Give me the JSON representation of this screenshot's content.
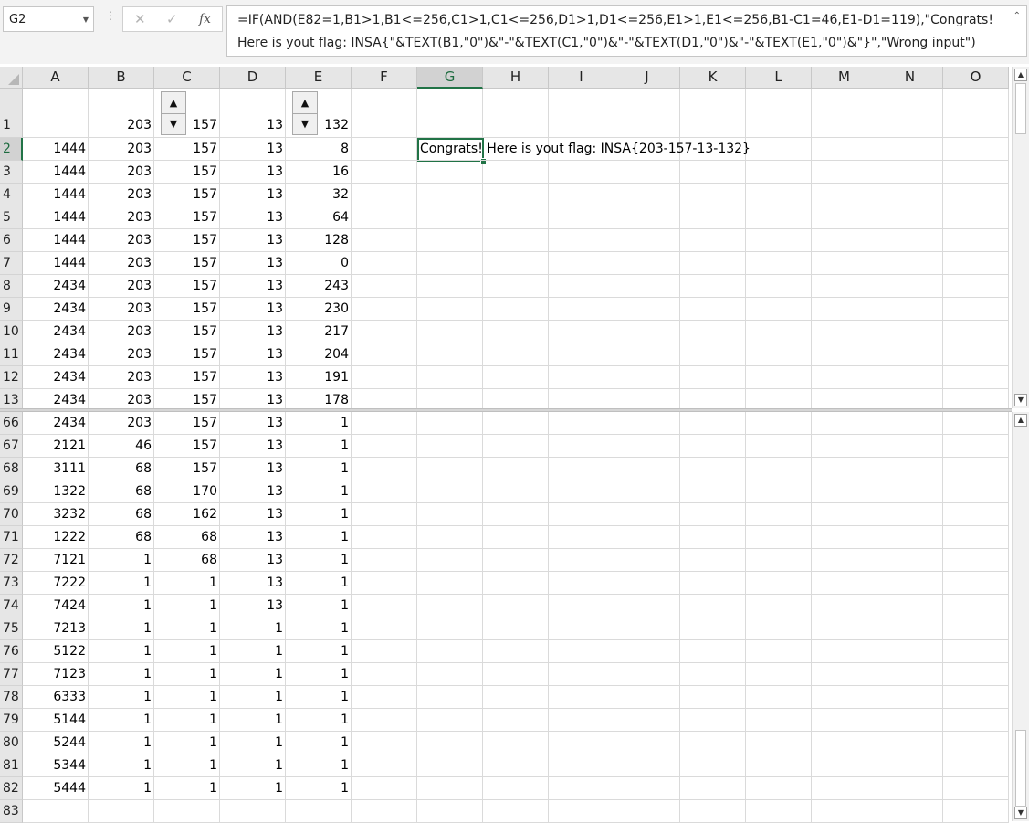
{
  "formula_bar": {
    "name_box": "G2",
    "cancel_icon": "✕",
    "enter_icon": "✓",
    "fx_label": "fx",
    "formula": "=IF(AND(E82=1,B1>1,B1<=256,C1>1,C1<=256,D1>1,D1<=256,E1>1,E1<=256,B1-C1=46,E1-D1=119),\"Congrats! Here is yout flag: INSA{\"&TEXT(B1,\"0\")&\"-\"&TEXT(C1,\"0\")&\"-\"&TEXT(D1,\"0\")&\"-\"&TEXT(E1,\"0\")&\"}\",\"Wrong input\")"
  },
  "columns": [
    "A",
    "B",
    "C",
    "D",
    "E",
    "F",
    "G",
    "H",
    "I",
    "J",
    "K",
    "L",
    "M",
    "N",
    "O"
  ],
  "selected_column": "G",
  "selected_row": "2",
  "rows": [
    {
      "n": "1",
      "A": "",
      "B": "203",
      "C": "157",
      "D": "13",
      "E": "132"
    },
    {
      "n": "2",
      "A": "1444",
      "B": "203",
      "C": "157",
      "D": "13",
      "E": "8",
      "G": "Congrats! Here is yout flag: INSA{203-157-13-132}"
    },
    {
      "n": "3",
      "A": "1444",
      "B": "203",
      "C": "157",
      "D": "13",
      "E": "16"
    },
    {
      "n": "4",
      "A": "1444",
      "B": "203",
      "C": "157",
      "D": "13",
      "E": "32"
    },
    {
      "n": "5",
      "A": "1444",
      "B": "203",
      "C": "157",
      "D": "13",
      "E": "64"
    },
    {
      "n": "6",
      "A": "1444",
      "B": "203",
      "C": "157",
      "D": "13",
      "E": "128"
    },
    {
      "n": "7",
      "A": "1444",
      "B": "203",
      "C": "157",
      "D": "13",
      "E": "0"
    },
    {
      "n": "8",
      "A": "2434",
      "B": "203",
      "C": "157",
      "D": "13",
      "E": "243"
    },
    {
      "n": "9",
      "A": "2434",
      "B": "203",
      "C": "157",
      "D": "13",
      "E": "230"
    },
    {
      "n": "10",
      "A": "2434",
      "B": "203",
      "C": "157",
      "D": "13",
      "E": "217"
    },
    {
      "n": "11",
      "A": "2434",
      "B": "203",
      "C": "157",
      "D": "13",
      "E": "204"
    },
    {
      "n": "12",
      "A": "2434",
      "B": "203",
      "C": "157",
      "D": "13",
      "E": "191"
    },
    {
      "n": "13",
      "A": "2434",
      "B": "203",
      "C": "157",
      "D": "13",
      "E": "178"
    },
    {
      "n": "66",
      "A": "2434",
      "B": "203",
      "C": "157",
      "D": "13",
      "E": "1"
    },
    {
      "n": "67",
      "A": "2121",
      "B": "46",
      "C": "157",
      "D": "13",
      "E": "1"
    },
    {
      "n": "68",
      "A": "3111",
      "B": "68",
      "C": "157",
      "D": "13",
      "E": "1"
    },
    {
      "n": "69",
      "A": "1322",
      "B": "68",
      "C": "170",
      "D": "13",
      "E": "1"
    },
    {
      "n": "70",
      "A": "3232",
      "B": "68",
      "C": "162",
      "D": "13",
      "E": "1"
    },
    {
      "n": "71",
      "A": "1222",
      "B": "68",
      "C": "68",
      "D": "13",
      "E": "1"
    },
    {
      "n": "72",
      "A": "7121",
      "B": "1",
      "C": "68",
      "D": "13",
      "E": "1"
    },
    {
      "n": "73",
      "A": "7222",
      "B": "1",
      "C": "1",
      "D": "13",
      "E": "1"
    },
    {
      "n": "74",
      "A": "7424",
      "B": "1",
      "C": "1",
      "D": "13",
      "E": "1"
    },
    {
      "n": "75",
      "A": "7213",
      "B": "1",
      "C": "1",
      "D": "1",
      "E": "1"
    },
    {
      "n": "76",
      "A": "5122",
      "B": "1",
      "C": "1",
      "D": "1",
      "E": "1"
    },
    {
      "n": "77",
      "A": "7123",
      "B": "1",
      "C": "1",
      "D": "1",
      "E": "1"
    },
    {
      "n": "78",
      "A": "6333",
      "B": "1",
      "C": "1",
      "D": "1",
      "E": "1"
    },
    {
      "n": "79",
      "A": "5144",
      "B": "1",
      "C": "1",
      "D": "1",
      "E": "1"
    },
    {
      "n": "80",
      "A": "5244",
      "B": "1",
      "C": "1",
      "D": "1",
      "E": "1"
    },
    {
      "n": "81",
      "A": "5344",
      "B": "1",
      "C": "1",
      "D": "1",
      "E": "1"
    },
    {
      "n": "82",
      "A": "5444",
      "B": "1",
      "C": "1",
      "D": "1",
      "E": "1"
    },
    {
      "n": "83"
    }
  ],
  "spinner_icons": {
    "up": "▲",
    "down": "▼"
  },
  "scroll_icons": {
    "up": "▲",
    "down": "▼",
    "collapse": "⌃"
  }
}
